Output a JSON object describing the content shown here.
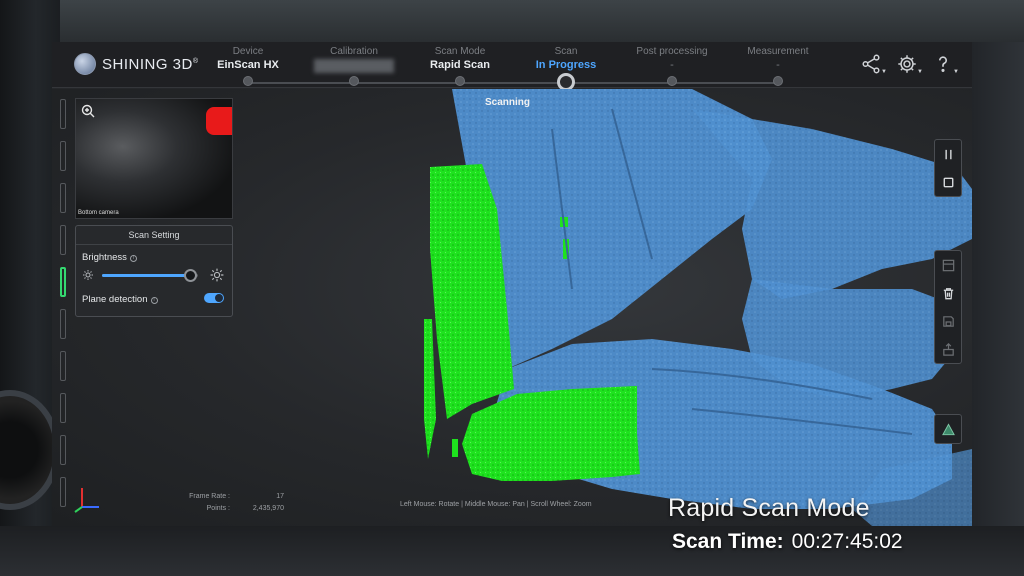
{
  "app": {
    "brand": "SHINING 3D",
    "brand_mark": "®"
  },
  "steps": [
    {
      "label": "Device",
      "value": "EinScan HX",
      "state": "done"
    },
    {
      "label": "Calibration",
      "value": "",
      "state": "blurred"
    },
    {
      "label": "Scan Mode",
      "value": "Rapid Scan",
      "state": "done"
    },
    {
      "label": "Scan",
      "value": "In Progress",
      "state": "current"
    },
    {
      "label": "Post processing",
      "value": "-",
      "state": "pending"
    },
    {
      "label": "Measurement",
      "value": "-",
      "state": "pending"
    }
  ],
  "top_icons": [
    "share-icon",
    "settings-icon",
    "help-icon"
  ],
  "viewport": {
    "status": "Scanning",
    "hint": "Left Mouse: Rotate | Middle Mouse: Pan | Scroll Wheel: Zoom"
  },
  "camera": {
    "label": "Bottom camera"
  },
  "scan_setting": {
    "title": "Scan Setting",
    "brightness_label": "Brightness",
    "brightness_level": 0.92,
    "plane_detection_label": "Plane detection",
    "plane_detection_on": true
  },
  "stats": {
    "frame_rate_label": "Frame Rate :",
    "frame_rate_value": "17",
    "points_label": "Points :",
    "points_value": "2,435,970"
  },
  "right_tools_top": [
    "pause-icon",
    "stop-icon"
  ],
  "right_tools_mid": [
    "layout-icon",
    "delete-icon",
    "save-icon",
    "export-icon"
  ],
  "right_tools_bottom": [
    "mesh-icon"
  ],
  "overlay": {
    "mode": "Rapid Scan Mode",
    "time_label": "Scan Time:",
    "time_value": "00:27:45:02"
  },
  "colors": {
    "accent": "#4ea6ff",
    "scan_blue": "#4f8fcf",
    "scan_green": "#1ee21e",
    "rail_active": "#34d870"
  }
}
